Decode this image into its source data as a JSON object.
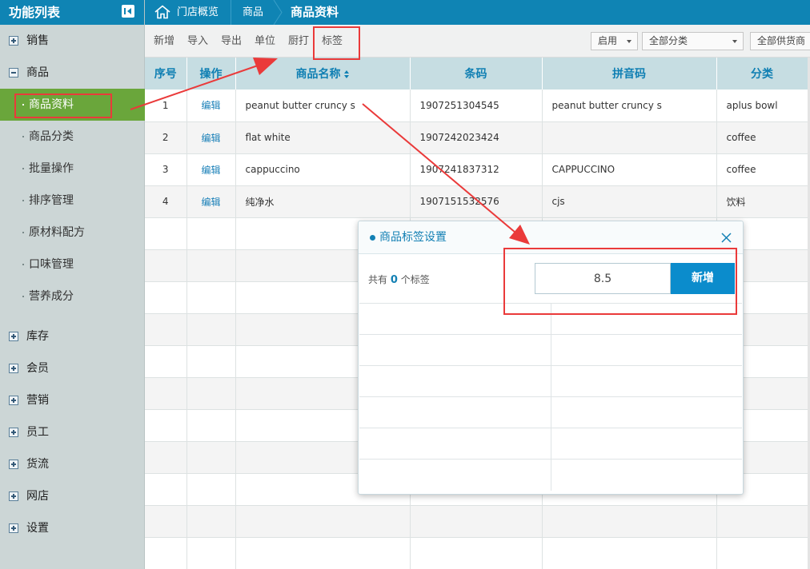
{
  "sidebar": {
    "title": "功能列表",
    "groups": [
      {
        "label": "销售"
      },
      {
        "label": "商品"
      },
      {
        "label": "库存"
      },
      {
        "label": "会员"
      },
      {
        "label": "营销"
      },
      {
        "label": "员工"
      },
      {
        "label": "货流"
      },
      {
        "label": "网店"
      },
      {
        "label": "设置"
      }
    ],
    "sub_items": [
      {
        "label": "商品资料",
        "active": true
      },
      {
        "label": "商品分类"
      },
      {
        "label": "批量操作"
      },
      {
        "label": "排序管理"
      },
      {
        "label": "原材料配方"
      },
      {
        "label": "口味管理"
      },
      {
        "label": "营养成分"
      }
    ]
  },
  "breadcrumb": {
    "home": "门店概览",
    "level1": "商品",
    "current": "商品资料"
  },
  "toolbar": {
    "buttons": [
      "新增",
      "导入",
      "导出",
      "单位",
      "厨打",
      "标签"
    ],
    "filters": {
      "status": "启用",
      "category": "全部分类",
      "supplier": "全部供货商"
    }
  },
  "table": {
    "columns": [
      "序号",
      "操作",
      "商品名称",
      "条码",
      "拼音码",
      "分类"
    ],
    "rows": [
      {
        "no": "1",
        "op": "编辑",
        "name": "peanut butter cruncy s",
        "barcode": "1907251304545",
        "pinyin": "peanut butter cruncy s",
        "category": "aplus bowl"
      },
      {
        "no": "2",
        "op": "编辑",
        "name": "flat white",
        "barcode": "1907242023424",
        "pinyin": "",
        "category": "coffee"
      },
      {
        "no": "3",
        "op": "编辑",
        "name": "cappuccino",
        "barcode": "1907241837312",
        "pinyin": "CAPPUCCINO",
        "category": "coffee"
      },
      {
        "no": "4",
        "op": "编辑",
        "name": "纯净水",
        "barcode": "1907151532576",
        "pinyin": "cjs",
        "category": "饮料"
      }
    ]
  },
  "dialog": {
    "title": "商品标签设置",
    "count_prefix": "共有",
    "count_value": "0",
    "count_suffix": "个标签",
    "input_value": "8.5",
    "add_label": "新增"
  },
  "colors": {
    "header_blue": "#0f84b4",
    "active_green": "#6aa63b",
    "annotation_red": "#ea3a3a"
  }
}
